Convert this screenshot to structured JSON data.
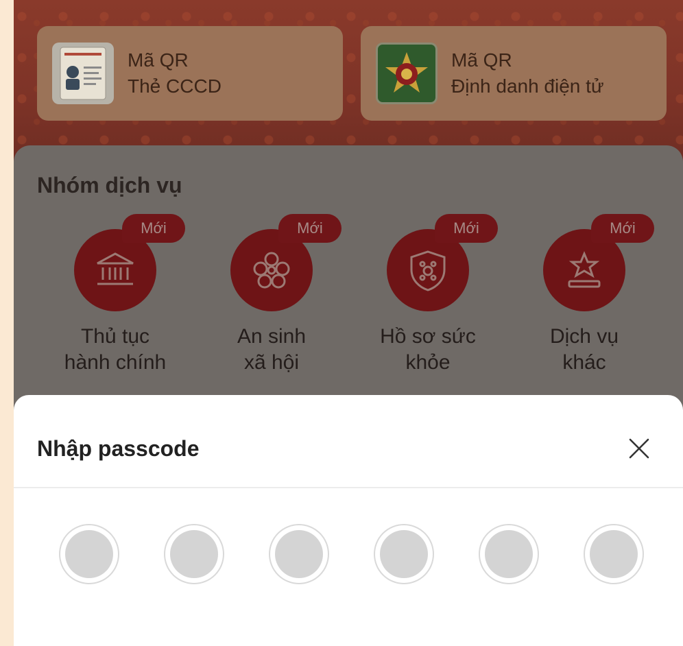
{
  "qr_cards": [
    {
      "line1": "Mã QR",
      "line2": "Thẻ CCCD",
      "icon": "id-card-icon"
    },
    {
      "line1": "Mã QR",
      "line2": "Định danh điện tử",
      "icon": "police-emblem-icon"
    }
  ],
  "services": {
    "title": "Nhóm dịch vụ",
    "items": [
      {
        "badge": "Mới",
        "label_line1": "Thủ tục",
        "label_line2": "hành chính",
        "icon": "government-building-icon"
      },
      {
        "badge": "Mới",
        "label_line1": "An sinh",
        "label_line2": "xã hội",
        "icon": "social-welfare-icon"
      },
      {
        "badge": "Mới",
        "label_line1": "Hồ sơ sức",
        "label_line2": "khỏe",
        "icon": "health-shield-icon"
      },
      {
        "badge": "Mới",
        "label_line1": "Dịch vụ",
        "label_line2": "khác",
        "icon": "star-podium-icon"
      }
    ]
  },
  "passcode_sheet": {
    "title": "Nhập passcode",
    "close_icon": "close-icon",
    "digit_count": 6,
    "filled_digits": 0
  },
  "colors": {
    "accent": "#6e1416",
    "sheet_bg": "#ffffff",
    "dot_fill": "#d4d4d4"
  }
}
